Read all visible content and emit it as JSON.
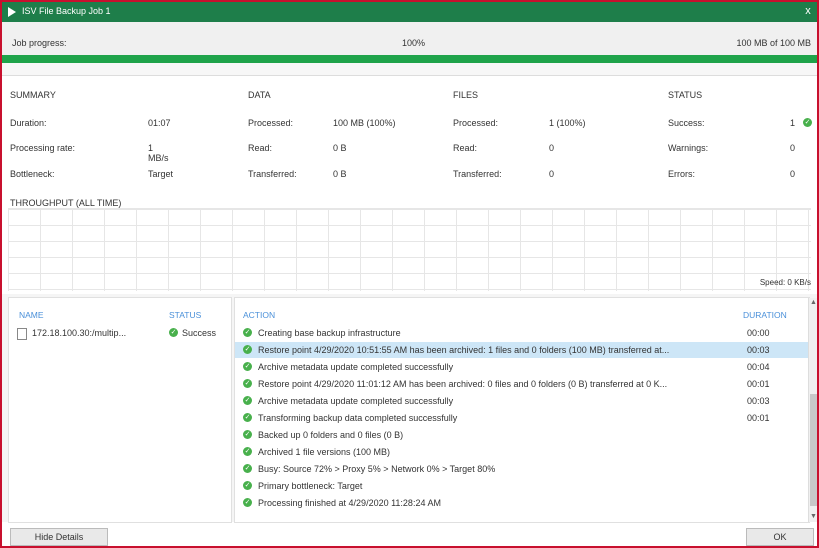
{
  "window": {
    "title": "ISV File Backup Job 1",
    "close": "x"
  },
  "progress": {
    "label": "Job progress:",
    "percent_text": "100%",
    "fraction": 1.0,
    "amount": "100 MB of 100 MB"
  },
  "summary": {
    "header": "SUMMARY",
    "rows": [
      {
        "k": "Duration:",
        "v": "01:07"
      },
      {
        "k": "Processing rate:",
        "v": "1 MB/s"
      },
      {
        "k": "Bottleneck:",
        "v": "Target"
      }
    ]
  },
  "data": {
    "header": "DATA",
    "rows": [
      {
        "k": "Processed:",
        "v": "100 MB (100%)"
      },
      {
        "k": "Read:",
        "v": "0 B"
      },
      {
        "k": "Transferred:",
        "v": "0 B"
      }
    ]
  },
  "files": {
    "header": "FILES",
    "rows": [
      {
        "k": "Processed:",
        "v": "1 (100%)"
      },
      {
        "k": "Read:",
        "v": "0"
      },
      {
        "k": "Transferred:",
        "v": "0"
      }
    ]
  },
  "status": {
    "header": "STATUS",
    "rows": [
      {
        "k": "Success:",
        "v": "1"
      },
      {
        "k": "Warnings:",
        "v": "0"
      },
      {
        "k": "Errors:",
        "v": "0"
      }
    ]
  },
  "throughput": {
    "title": "THROUGHPUT (ALL TIME)",
    "speed": "Speed: 0 KB/s"
  },
  "objects": {
    "col_name": "NAME",
    "col_status": "STATUS",
    "rows": [
      {
        "name": "172.18.100.30:/multip...",
        "status": "Success"
      }
    ]
  },
  "log": {
    "col_action": "ACTION",
    "col_duration": "DURATION",
    "rows": [
      {
        "text": "Creating base backup infrastructure",
        "duration": "00:00"
      },
      {
        "text": "Restore point 4/29/2020 10:51:55 AM has been archived: 1 files and 0 folders (100 MB) transferred at...",
        "duration": "00:03",
        "selected": true
      },
      {
        "text": "Archive metadata update completed successfully",
        "duration": "00:04"
      },
      {
        "text": "Restore point 4/29/2020 11:01:12 AM has been archived: 0 files and 0 folders (0 B) transferred at 0 K...",
        "duration": "00:01"
      },
      {
        "text": "Archive metadata update completed successfully",
        "duration": "00:03"
      },
      {
        "text": "Transforming backup data completed successfully",
        "duration": "00:01"
      },
      {
        "text": "Backed up 0 folders and 0 files (0 B)",
        "duration": ""
      },
      {
        "text": "Archived 1 file versions (100 MB)",
        "duration": ""
      },
      {
        "text": "Busy: Source 72% > Proxy 5% > Network 0% > Target 80%",
        "duration": ""
      },
      {
        "text": "Primary bottleneck: Target",
        "duration": ""
      },
      {
        "text": "Processing finished at 4/29/2020 11:28:24 AM",
        "duration": ""
      }
    ]
  },
  "buttons": {
    "hide_details": "Hide Details",
    "ok": "OK"
  },
  "colors": {
    "title_bar": "#1e7e4a",
    "progress": "#1fa34a",
    "success": "#48b04c",
    "selected_row": "#cde6f7",
    "accent_header": "#4a90d9"
  }
}
